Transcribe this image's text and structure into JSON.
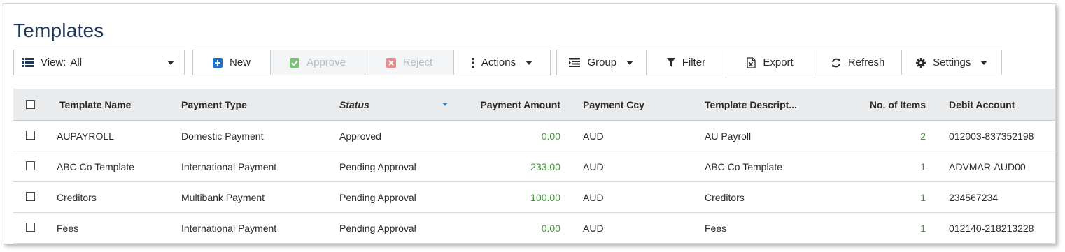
{
  "page": {
    "title": "Templates"
  },
  "view": {
    "label": "View:",
    "value": "All"
  },
  "toolbar": {
    "new_label": "New",
    "approve_label": "Approve",
    "reject_label": "Reject",
    "actions_label": "Actions",
    "group_label": "Group",
    "filter_label": "Filter",
    "export_label": "Export",
    "refresh_label": "Refresh",
    "settings_label": "Settings"
  },
  "table": {
    "columns": {
      "template_name": "Template Name",
      "payment_type": "Payment Type",
      "status": "Status",
      "payment_amount": "Payment Amount",
      "payment_ccy": "Payment Ccy",
      "template_description": "Template Descript...",
      "no_of_items": "No. of Items",
      "debit_account": "Debit Account"
    },
    "rows": [
      {
        "name": "AUPAYROLL",
        "type": "Domestic Payment",
        "status": "Approved",
        "amount": "0.00",
        "ccy": "AUD",
        "desc": "AU Payroll",
        "items": "2",
        "account": "012003-837352198"
      },
      {
        "name": "ABC Co Template",
        "type": "International Payment",
        "status": "Pending Approval",
        "amount": "233.00",
        "ccy": "AUD",
        "desc": "ABC Co Template",
        "items": "1",
        "account": "ADVMAR-AUD00"
      },
      {
        "name": "Creditors",
        "type": "Multibank Payment",
        "status": "Pending Approval",
        "amount": "100.00",
        "ccy": "AUD",
        "desc": "Creditors",
        "items": "1",
        "account": "234567234"
      },
      {
        "name": "Fees",
        "type": "International Payment",
        "status": "Pending Approval",
        "amount": "0.00",
        "ccy": "AUD",
        "desc": "Fees",
        "items": "1",
        "account": "012140-218213228"
      }
    ]
  },
  "colors": {
    "title": "#1f3a5a",
    "new_icon": "#1f73c6",
    "approve_icon": "#7cc17a",
    "reject_icon": "#e88c8c",
    "amount_green": "#3a9a2e",
    "sort_indicator": "#3f7fc2",
    "header_bg": "#e9ebed"
  },
  "icons": {
    "view": "list-icon",
    "new": "plus-square-icon",
    "approve": "check-square-icon",
    "reject": "x-square-icon",
    "actions": "vertical-dots-icon",
    "group": "group-list-icon",
    "filter": "funnel-icon",
    "export": "excel-file-icon",
    "refresh": "refresh-icon",
    "settings": "gear-icon"
  }
}
